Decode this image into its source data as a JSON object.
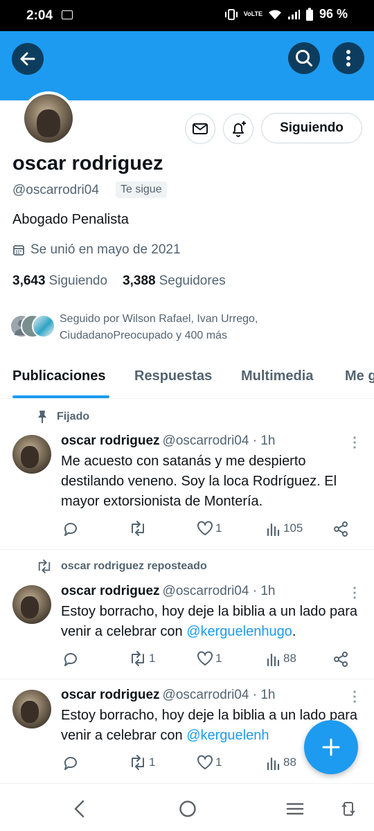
{
  "status_bar": {
    "time": "2:04",
    "battery": "96 %"
  },
  "profile": {
    "name": "oscar rodriguez",
    "handle": "@oscarrodri04",
    "follows_you": "Te sigue",
    "bio": "Abogado Penalista",
    "joined": "Se unió en mayo de 2021",
    "following_count": "3,643",
    "following_label": "Siguiendo",
    "followers_count": "3,388",
    "followers_label": "Seguidores",
    "followed_by_line1": "Seguido por Wilson Rafael, Ivan Urrego,",
    "followed_by_line2": "CiudadanoPreocupado y 400 más",
    "follow_button": "Siguiendo"
  },
  "tabs": [
    {
      "label": "Publicaciones"
    },
    {
      "label": "Respuestas"
    },
    {
      "label": "Multimedia"
    },
    {
      "label": "Me g"
    }
  ],
  "posts": [
    {
      "context": "Fijado",
      "name": "oscar rodriguez",
      "handle": "@oscarrodri04 · 1h",
      "text": "Me acuesto con satanás y me despierto destilando veneno. Soy la loca Rodríguez. El mayor extorsionista de Montería.",
      "reposts": "",
      "likes": "1",
      "views": "105"
    },
    {
      "context": "oscar rodriguez reposteado",
      "name": "oscar rodriguez",
      "handle": "@oscarrodri04 · 1h",
      "text_before": "Estoy borracho, hoy deje la biblia a un lado para venir a celebrar con ",
      "mention": "@kerguelenhugo",
      "text_after": ".",
      "reposts": "1",
      "likes": "1",
      "views": "88"
    },
    {
      "name": "oscar rodriguez",
      "handle": "@oscarrodri04 · 1h",
      "text_before": "Estoy borracho, hoy deje la biblia a un lado para venir a celebrar con ",
      "mention": "@kerguelenh",
      "reposts": "1",
      "likes": "1",
      "views": "88"
    }
  ],
  "colors": {
    "accent": "#1d9bf0",
    "secondary_text": "#536471"
  }
}
